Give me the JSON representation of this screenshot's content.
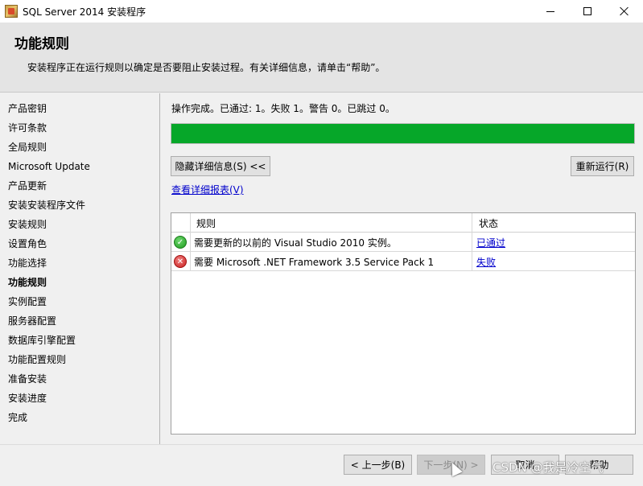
{
  "window": {
    "title": "SQL Server 2014 安装程序"
  },
  "header": {
    "title": "功能规则",
    "description": "安装程序正在运行规则以确定是否要阻止安装过程。有关详细信息，请单击“帮助”。"
  },
  "sidebar": {
    "items": [
      {
        "label": "产品密钥"
      },
      {
        "label": "许可条款"
      },
      {
        "label": "全局规则"
      },
      {
        "label": "Microsoft Update"
      },
      {
        "label": "产品更新"
      },
      {
        "label": "安装安装程序文件"
      },
      {
        "label": "安装规则"
      },
      {
        "label": "设置角色"
      },
      {
        "label": "功能选择"
      },
      {
        "label": "功能规则"
      },
      {
        "label": "实例配置"
      },
      {
        "label": "服务器配置"
      },
      {
        "label": "数据库引擎配置"
      },
      {
        "label": "功能配置规则"
      },
      {
        "label": "准备安装"
      },
      {
        "label": "安装进度"
      },
      {
        "label": "完成"
      }
    ],
    "active_index": 9
  },
  "main": {
    "status_text": "操作完成。已通过: 1。失败 1。警告 0。已跳过 0。",
    "progress": 1.0,
    "progress_color": "#06a729",
    "hide_details_label": "隐藏详细信息(S) <<",
    "rerun_label": "重新运行(R)",
    "report_link": "查看详细报表(V)",
    "table": {
      "headers": [
        "规则",
        "状态"
      ],
      "rows": [
        {
          "icon": "check-icon",
          "rule": "需要更新的以前的 Visual Studio 2010 实例。",
          "status": "已通过"
        },
        {
          "icon": "error-icon",
          "rule": "需要 Microsoft .NET Framework 3.5 Service Pack 1",
          "status": "失败"
        }
      ]
    }
  },
  "footer": {
    "back_label": "< 上一步(B)",
    "next_label": "下一步(N) >",
    "cancel_label": "取消",
    "help_label": "帮助"
  },
  "watermark": "CSDN @我是冷空气"
}
